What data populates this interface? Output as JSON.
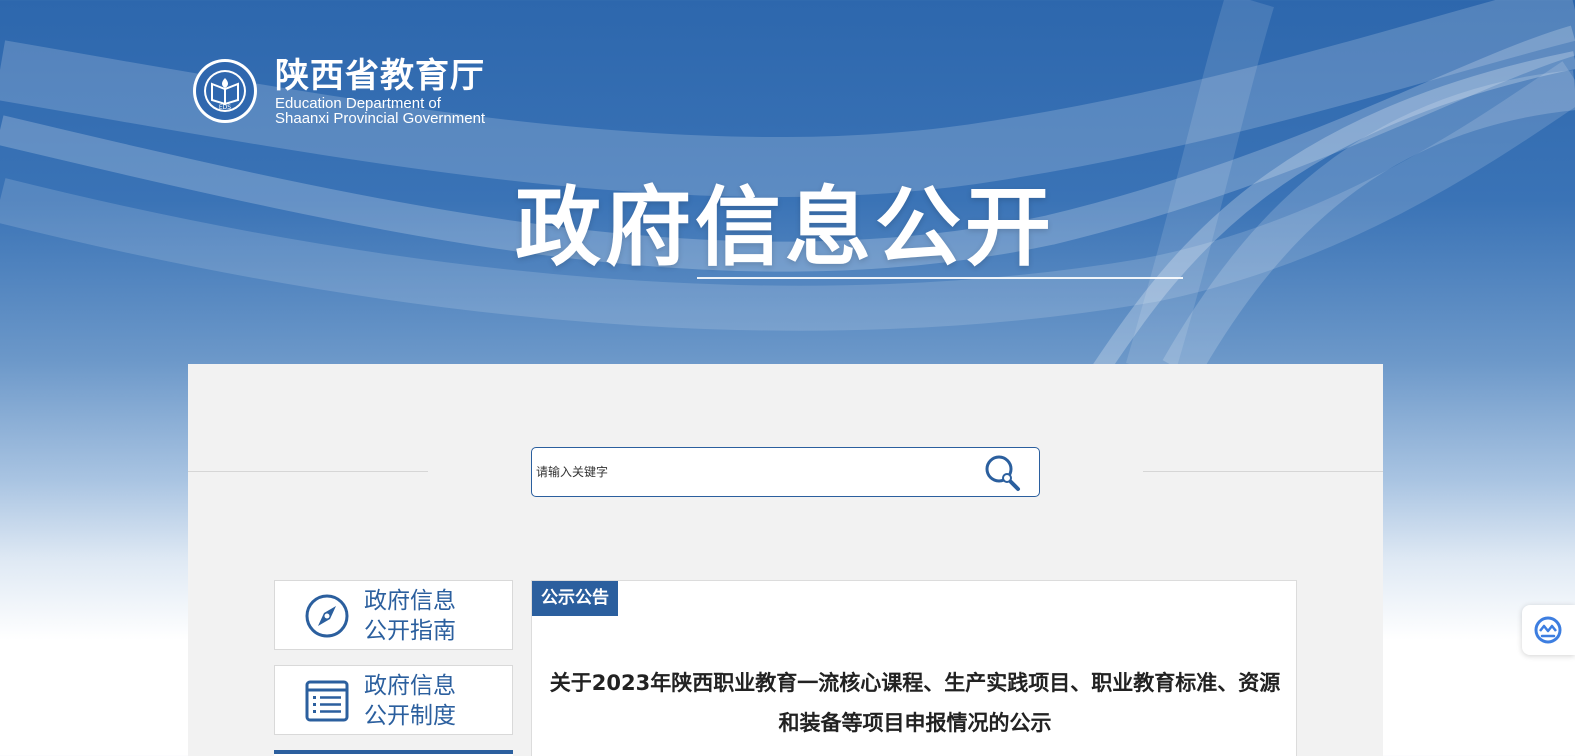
{
  "header": {
    "logo_cn": "陕西省教育厅",
    "logo_en_line1": "Education Department of",
    "logo_en_line2": "Shaanxi Provincial Government",
    "logo_emblem_text": "EDS",
    "hero_title": "政府信息公开"
  },
  "search": {
    "placeholder": "请输入关键字",
    "icon": "search-icon"
  },
  "sidebar": {
    "items": [
      {
        "line1": "政府信息",
        "line2": "公开指南",
        "icon": "compass-icon"
      },
      {
        "line1": "政府信息",
        "line2": "公开制度",
        "icon": "document-list-icon"
      }
    ]
  },
  "notice": {
    "tag": "公示公告",
    "title_line1": "关于2023年陕西职业教育一流核心课程、生产实践项目、职业教育标准、资源",
    "title_line2": "和装备等项目申报情况的公示"
  },
  "float_tool": {
    "icon": "accessibility-tool-icon"
  },
  "colors": {
    "primary": "#2b5f9e",
    "hero_top": "#2d67ad",
    "panel_bg": "#f2f2f2"
  }
}
